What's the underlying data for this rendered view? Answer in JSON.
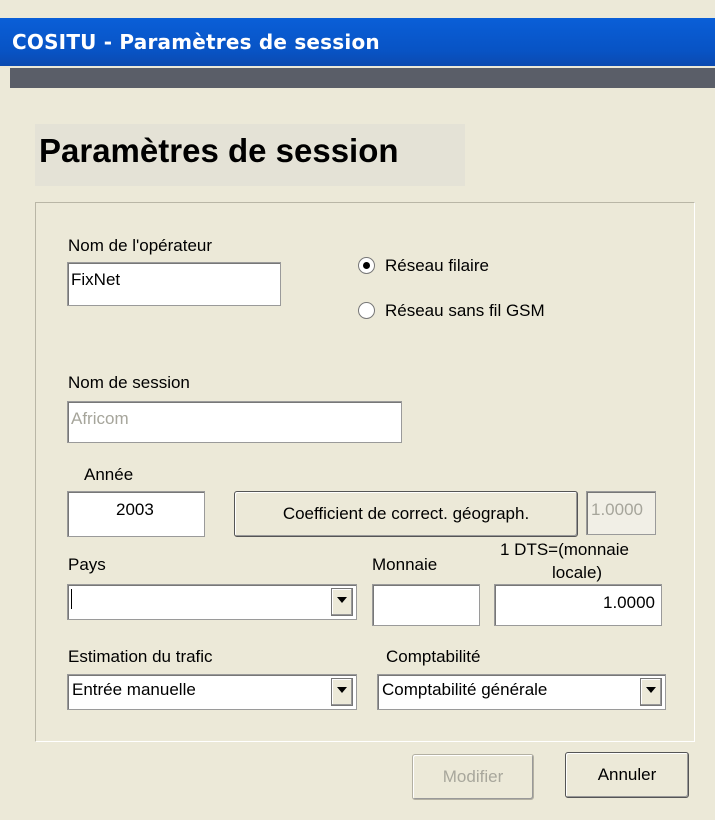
{
  "window": {
    "title": "COSITU - Paramètres de session"
  },
  "heading": "Paramètres de session",
  "operator": {
    "label": "Nom de l'opérateur",
    "value": "FixNet"
  },
  "network": {
    "options": [
      {
        "label": "Réseau filaire",
        "checked": true
      },
      {
        "label": "Réseau sans fil GSM",
        "checked": false
      }
    ]
  },
  "session": {
    "label": "Nom de session",
    "value": "Africom"
  },
  "year": {
    "label": "Année",
    "value": "2003"
  },
  "geo": {
    "button_label": "Coefficient de correct. géograph.",
    "value": "1.0000"
  },
  "country": {
    "label": "Pays",
    "value": ""
  },
  "currency": {
    "label": "Monnaie",
    "value": ""
  },
  "dts": {
    "label_line1": "1 DTS=(monnaie",
    "label_line2": "locale)",
    "value": "1.0000"
  },
  "traffic": {
    "label": "Estimation du trafic",
    "value": "Entrée manuelle"
  },
  "accounting": {
    "label": "Comptabilité",
    "value": "Comptabilité générale"
  },
  "buttons": {
    "modify": "Modifier",
    "cancel": "Annuler"
  }
}
